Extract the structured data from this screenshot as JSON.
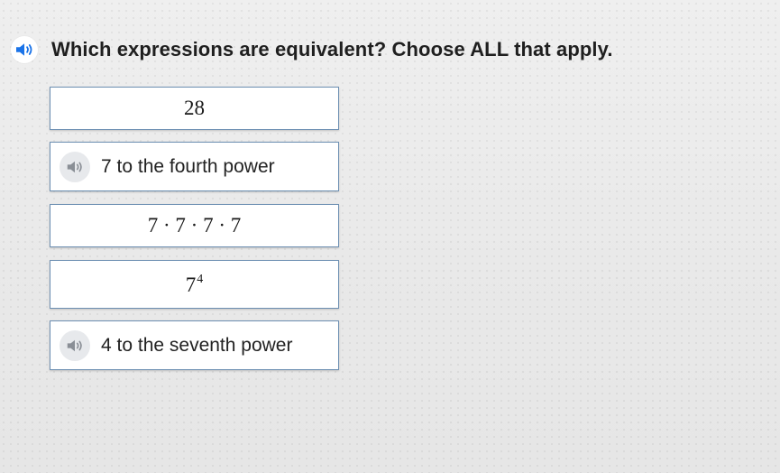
{
  "question": {
    "text": "Which expressions are equivalent? Choose ALL that apply.",
    "speaker_icon": "speaker-icon"
  },
  "choices": [
    {
      "kind": "math",
      "text": "28"
    },
    {
      "kind": "audio",
      "text": "7 to the fourth power",
      "icon": "speaker-icon"
    },
    {
      "kind": "math",
      "text": "7 · 7 · 7 · 7"
    },
    {
      "kind": "power",
      "base": "7",
      "exponent": "4"
    },
    {
      "kind": "audio",
      "text": "4 to the seventh power",
      "icon": "speaker-icon"
    }
  ],
  "colors": {
    "accent": "#1a73e8",
    "choice_border": "#6d8fb2",
    "muted_icon": "#8a8f96"
  }
}
